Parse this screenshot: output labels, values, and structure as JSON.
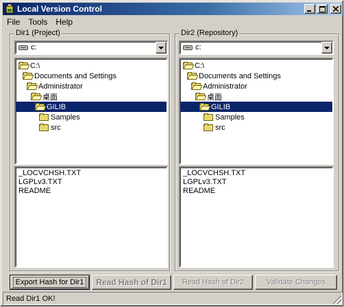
{
  "window": {
    "title": "Local Version Control",
    "icon": "app-icon"
  },
  "menu": [
    "File",
    "Tools",
    "Help"
  ],
  "left_panel": {
    "group_label": "Dir1 (Project)",
    "drive": "c:",
    "tree": [
      {
        "label": "C:\\",
        "indent": 0,
        "open": true,
        "selected": false
      },
      {
        "label": "Documents and Settings",
        "indent": 1,
        "open": true,
        "selected": false
      },
      {
        "label": "Administrator",
        "indent": 2,
        "open": true,
        "selected": false
      },
      {
        "label": "桌面",
        "indent": 3,
        "open": true,
        "selected": false
      },
      {
        "label": "GILIB",
        "indent": 4,
        "open": true,
        "selected": true
      },
      {
        "label": "Samples",
        "indent": 5,
        "open": false,
        "selected": false
      },
      {
        "label": "src",
        "indent": 5,
        "open": false,
        "selected": false
      }
    ],
    "files": [
      "_LOCVCHSH.TXT",
      "LGPLv3.TXT",
      "README"
    ]
  },
  "right_panel": {
    "group_label": "Dir2 (Repository)",
    "drive": "c:",
    "tree": [
      {
        "label": "C:\\",
        "indent": 0,
        "open": true,
        "selected": false
      },
      {
        "label": "Documents and Settings",
        "indent": 1,
        "open": true,
        "selected": false
      },
      {
        "label": "Administrator",
        "indent": 2,
        "open": true,
        "selected": false
      },
      {
        "label": "桌面",
        "indent": 3,
        "open": true,
        "selected": false
      },
      {
        "label": "GILIB",
        "indent": 4,
        "open": true,
        "selected": true
      },
      {
        "label": "Samples",
        "indent": 5,
        "open": false,
        "selected": false
      },
      {
        "label": "src",
        "indent": 5,
        "open": false,
        "selected": false
      }
    ],
    "files": [
      "_LOCVCHSH.TXT",
      "LGPLv3.TXT",
      "README"
    ]
  },
  "buttons": {
    "export_hash_dir1": "Export Hash for Dir1",
    "read_hash_dir1": "Read Hash of Dir1",
    "read_hash_dir2": "Read Hash of Dir2",
    "validate_changes": "Validate Changes"
  },
  "status": "Read Dir1 OK!",
  "colors": {
    "title_bar": "#0a246a",
    "selection": "#0a246a",
    "face": "#d4d0c8"
  }
}
